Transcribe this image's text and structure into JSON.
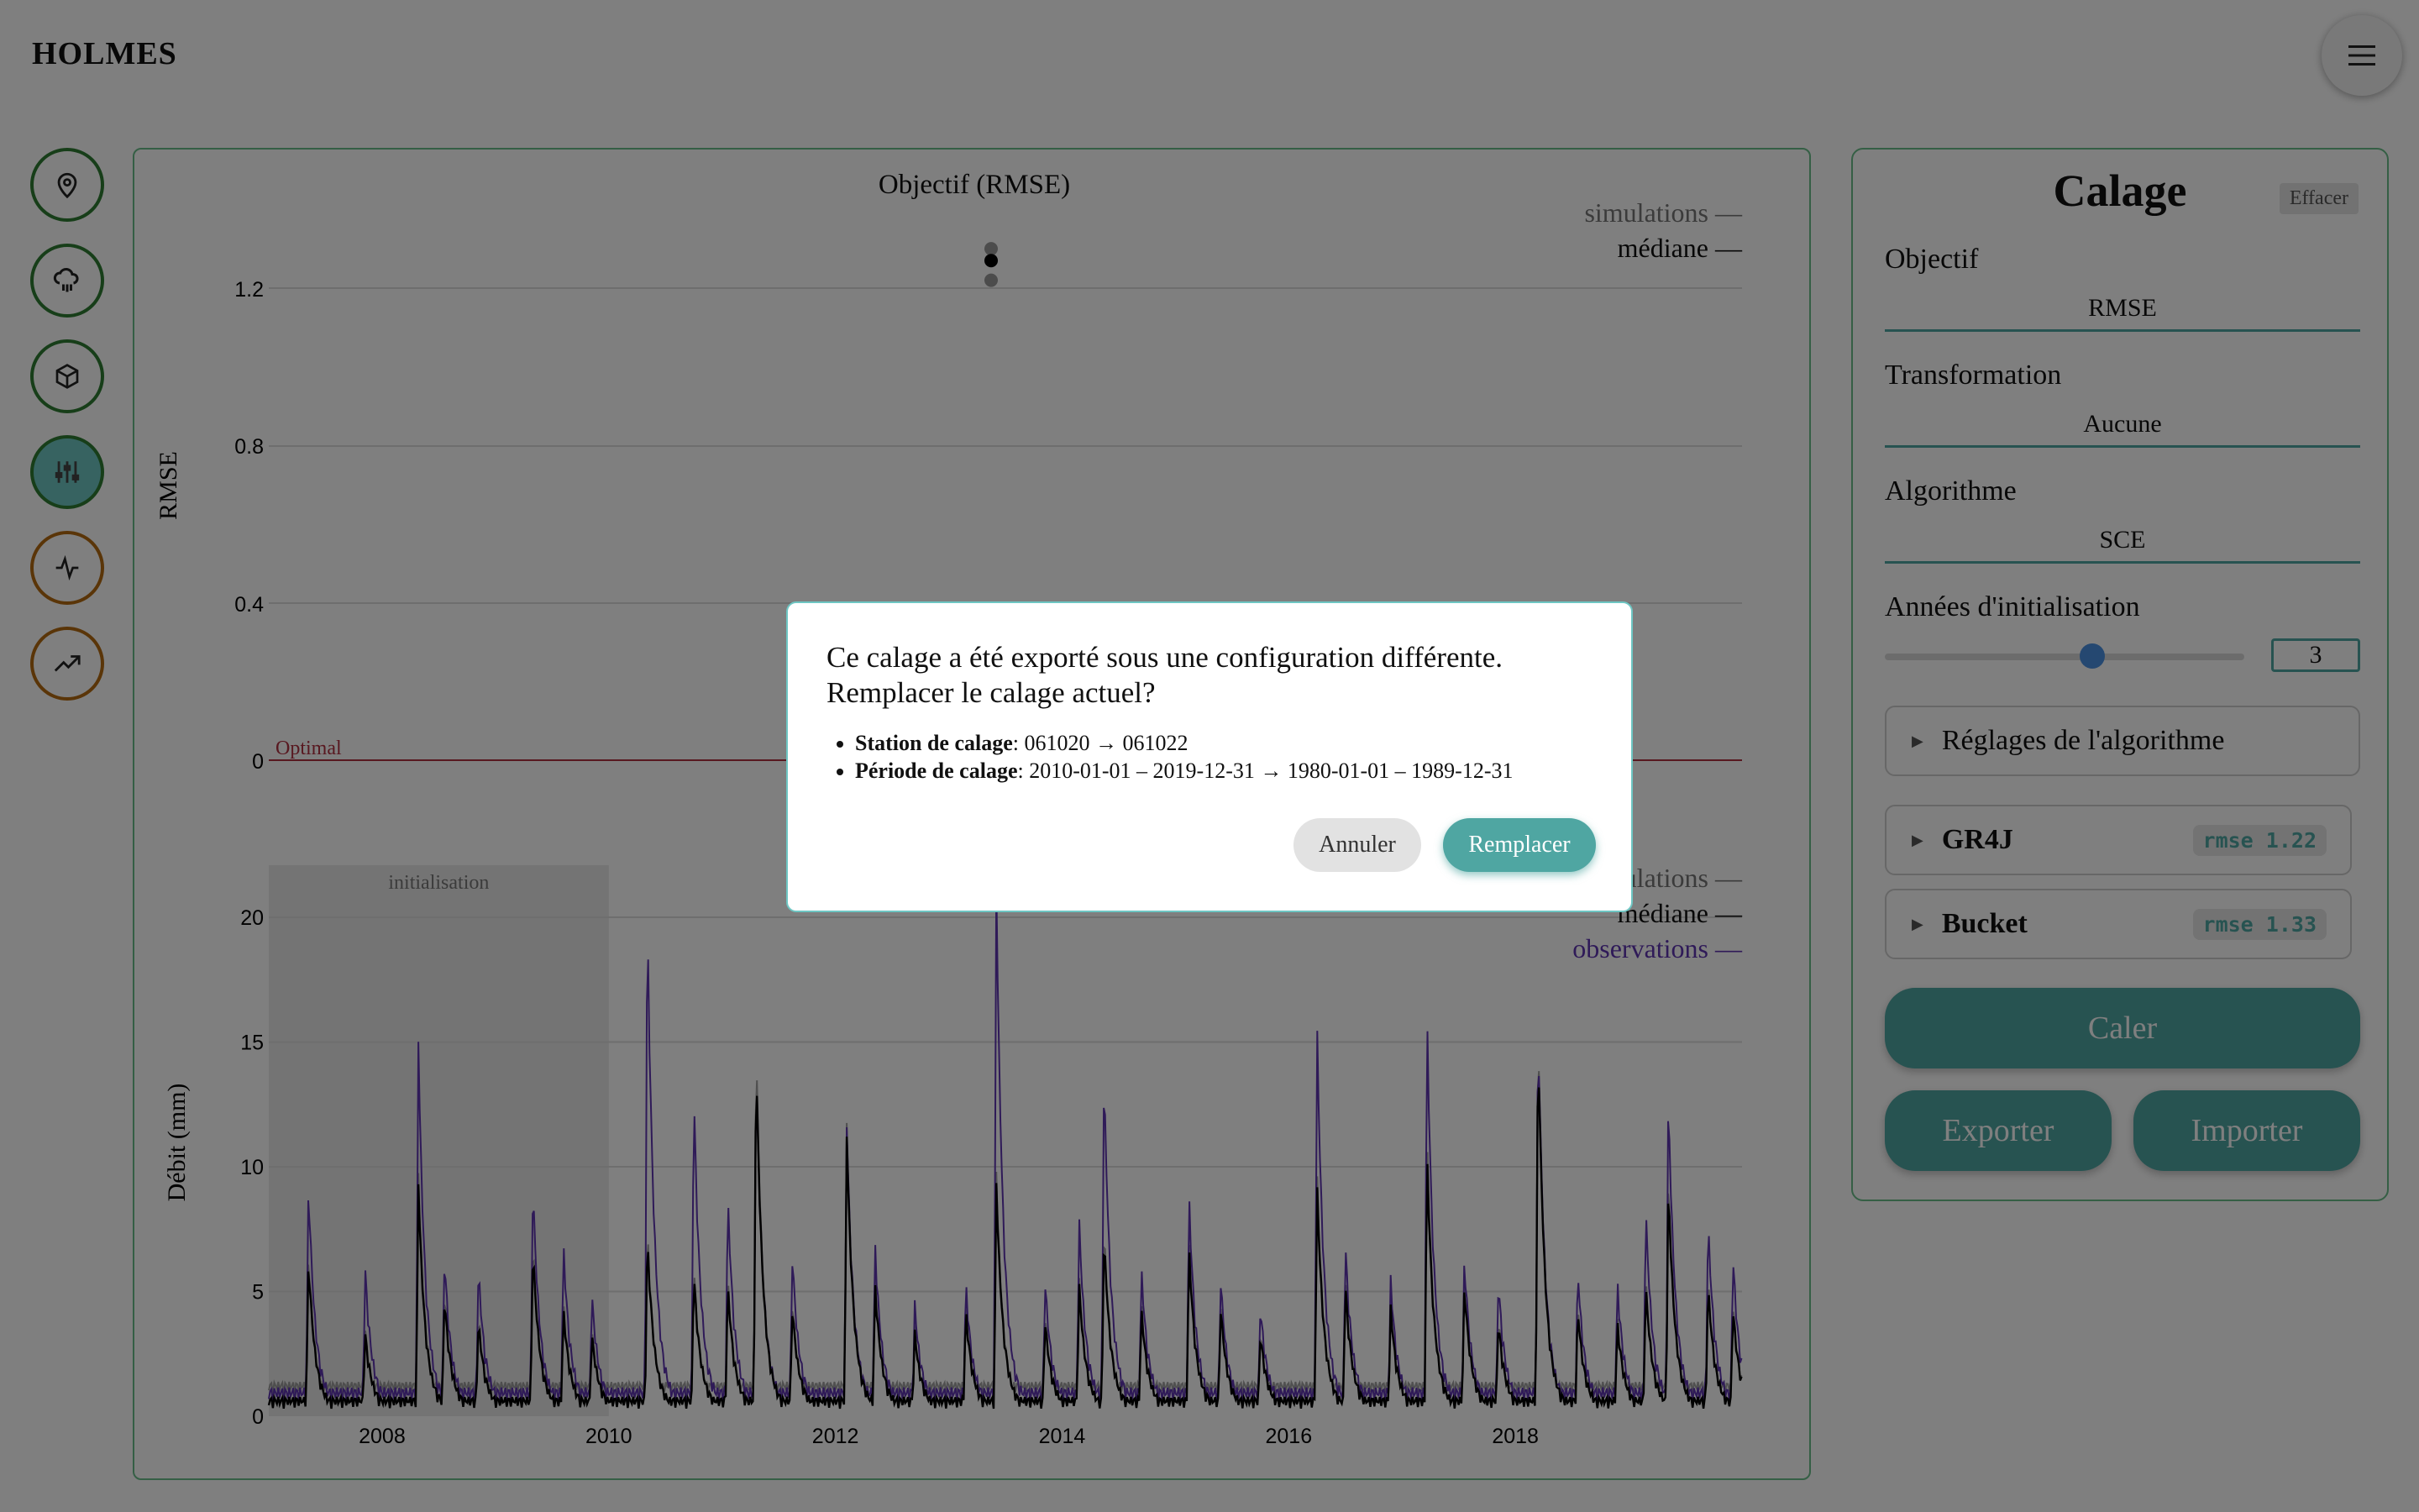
{
  "app": {
    "title": "HOLMES"
  },
  "header": {
    "menu_icon": "hamburger-icon"
  },
  "sidebar": {
    "items": [
      {
        "icon": "map-pin-icon",
        "color": "#2e7d32",
        "active": false
      },
      {
        "icon": "cloud-rain-icon",
        "color": "#2e7d32",
        "active": false
      },
      {
        "icon": "cube-icon",
        "color": "#2e7d32",
        "active": false
      },
      {
        "icon": "sliders-icon",
        "color": "#2e7d32",
        "active": true
      },
      {
        "icon": "activity-icon",
        "color": "#b46a10",
        "active": false
      },
      {
        "icon": "trending-up-icon",
        "color": "#b46a10",
        "active": false
      }
    ]
  },
  "chart_data": [
    {
      "type": "scatter",
      "title": "Objectif (RMSE)",
      "ylabel": "RMSE",
      "yticks": [
        "1.2",
        "0.8",
        "0.4",
        "0"
      ],
      "ylim": [
        0,
        1.3
      ],
      "legend": [
        "simulations —",
        "médiane —"
      ],
      "legend_position": "top-right",
      "optimal_label": "Optimal",
      "optimal_value": 0,
      "points": [
        {
          "y": 1.3,
          "kind": "simulation"
        },
        {
          "y": 1.27,
          "kind": "median"
        },
        {
          "y": 1.22,
          "kind": "simulation"
        }
      ]
    },
    {
      "type": "line",
      "ylabel": "Débit (mm)",
      "yticks": [
        "20",
        "15",
        "10",
        "5",
        "0"
      ],
      "xticks": [
        "2008",
        "2010",
        "2012",
        "2014",
        "2016",
        "2018"
      ],
      "ylim": [
        0,
        21
      ],
      "xlim": [
        2007.0,
        2020.0
      ],
      "init_label": "initialisation",
      "init_range": [
        2007.0,
        2010.0
      ],
      "legend": [
        "simulations —",
        "médiane —",
        "observations —"
      ],
      "legend_position": "top-right",
      "series_colors": {
        "observations": "#5e35b1",
        "mediane": "#000000",
        "simulations": "#8a8a8a"
      },
      "peaks": [
        {
          "x": 2007.35,
          "obs": 9.0,
          "med": 6.0
        },
        {
          "x": 2007.85,
          "obs": 5.5,
          "med": 3.0
        },
        {
          "x": 2008.32,
          "obs": 14.6,
          "med": 9.0
        },
        {
          "x": 2008.55,
          "obs": 6.0,
          "med": 4.5
        },
        {
          "x": 2008.85,
          "obs": 5.5,
          "med": 3.5
        },
        {
          "x": 2009.33,
          "obs": 9.0,
          "med": 6.5
        },
        {
          "x": 2009.6,
          "obs": 6.5,
          "med": 4.0
        },
        {
          "x": 2009.85,
          "obs": 4.5,
          "med": 3.0
        },
        {
          "x": 2010.34,
          "obs": 20.2,
          "med": 7.0
        },
        {
          "x": 2010.75,
          "obs": 12.8,
          "med": 5.5
        },
        {
          "x": 2011.05,
          "obs": 8.5,
          "med": 5.0
        },
        {
          "x": 2011.3,
          "obs": 14.0,
          "med": 14.2
        },
        {
          "x": 2011.62,
          "obs": 6.0,
          "med": 4.0
        },
        {
          "x": 2012.1,
          "obs": 11.3,
          "med": 11.0
        },
        {
          "x": 2012.35,
          "obs": 6.5,
          "med": 5.0
        },
        {
          "x": 2012.7,
          "obs": 4.0,
          "med": 3.0
        },
        {
          "x": 2013.15,
          "obs": 5.0,
          "med": 4.0
        },
        {
          "x": 2013.42,
          "obs": 21.0,
          "med": 9.0
        },
        {
          "x": 2013.85,
          "obs": 5.0,
          "med": 3.5
        },
        {
          "x": 2014.15,
          "obs": 7.5,
          "med": 5.0
        },
        {
          "x": 2014.37,
          "obs": 13.5,
          "med": 7.0
        },
        {
          "x": 2014.7,
          "obs": 5.5,
          "med": 4.0
        },
        {
          "x": 2015.12,
          "obs": 8.5,
          "med": 6.5
        },
        {
          "x": 2015.4,
          "obs": 5.0,
          "med": 4.0
        },
        {
          "x": 2015.75,
          "obs": 4.0,
          "med": 3.0
        },
        {
          "x": 2016.25,
          "obs": 15.3,
          "med": 9.0
        },
        {
          "x": 2016.5,
          "obs": 6.5,
          "med": 5.0
        },
        {
          "x": 2016.9,
          "obs": 5.0,
          "med": 4.0
        },
        {
          "x": 2017.22,
          "obs": 15.8,
          "med": 10.3
        },
        {
          "x": 2017.55,
          "obs": 6.0,
          "med": 5.0
        },
        {
          "x": 2017.85,
          "obs": 5.0,
          "med": 3.5
        },
        {
          "x": 2018.2,
          "obs": 15.5,
          "med": 15.0
        },
        {
          "x": 2018.55,
          "obs": 5.5,
          "med": 4.0
        },
        {
          "x": 2018.9,
          "obs": 5.0,
          "med": 3.5
        },
        {
          "x": 2019.15,
          "obs": 8.0,
          "med": 5.0
        },
        {
          "x": 2019.35,
          "obs": 12.5,
          "med": 9.0
        },
        {
          "x": 2019.7,
          "obs": 7.5,
          "med": 5.0
        },
        {
          "x": 2019.92,
          "obs": 6.0,
          "med": 4.0
        }
      ]
    }
  ],
  "calage": {
    "title": "Calage",
    "clear_label": "Effacer",
    "objective_label": "Objectif",
    "objective_value": "RMSE",
    "transformation_label": "Transformation",
    "transformation_value": "Aucune",
    "algorithm_label": "Algorithme",
    "algorithm_value": "SCE",
    "init_years_label": "Années d'initialisation",
    "init_years_value": "3",
    "init_years_fraction": 0.6,
    "algo_settings_label": "Réglages de l'algorithme",
    "models": [
      {
        "name": "GR4J",
        "rmse": "rmse 1.22"
      },
      {
        "name": "Bucket",
        "rmse": "rmse 1.33"
      }
    ],
    "run_label": "Caler",
    "export_label": "Exporter",
    "import_label": "Importer"
  },
  "modal": {
    "title_line1": "Ce calage a été exporté sous une configuration différente.",
    "title_line2": "Remplacer le calage actuel?",
    "items": [
      {
        "label": "Station de calage",
        "value": ": 061020 → 061022"
      },
      {
        "label": "Période de calage",
        "value": ": 2010-01-01 – 2019-12-31 → 1980-01-01 – 1989-12-31"
      }
    ],
    "cancel_label": "Annuler",
    "replace_label": "Remplacer"
  }
}
